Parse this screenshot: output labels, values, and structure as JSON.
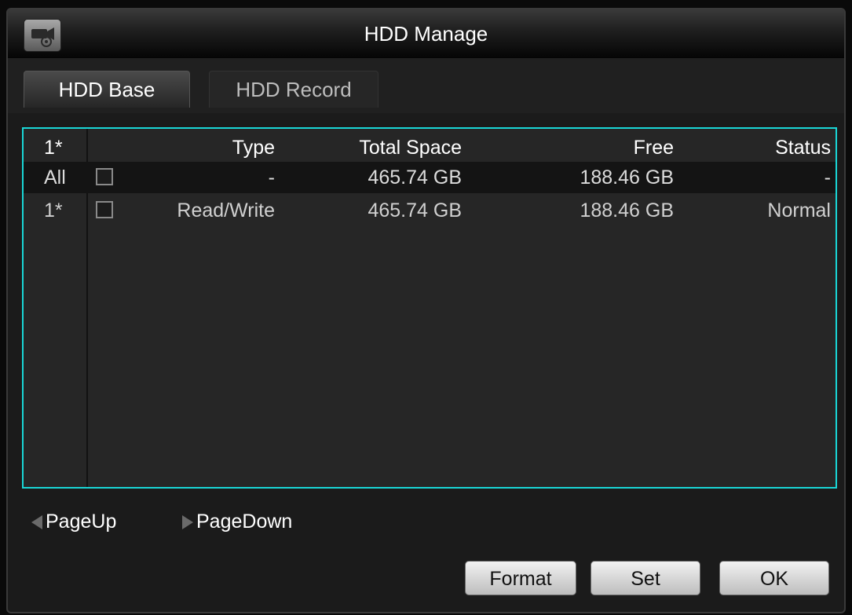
{
  "window": {
    "title": "HDD Manage",
    "logo_icon": "camera-logo-icon"
  },
  "tabs": [
    {
      "label": "HDD Base",
      "active": true
    },
    {
      "label": "HDD Record",
      "active": false
    }
  ],
  "table": {
    "columns": {
      "index": "1*",
      "type": "Type",
      "total": "Total Space",
      "free": "Free",
      "status": "Status"
    },
    "rows": [
      {
        "index": "All",
        "type": "-",
        "total": "465.74 GB",
        "free": "188.46 GB",
        "status": "-",
        "checked": false
      },
      {
        "index": "1*",
        "type": "Read/Write",
        "total": "465.74 GB",
        "free": "188.46 GB",
        "status": "Normal",
        "checked": false
      }
    ]
  },
  "pager": {
    "up_label": "PageUp",
    "down_label": "PageDown"
  },
  "buttons": {
    "format_label": "Format",
    "set_label": "Set",
    "ok_label": "OK"
  },
  "colors": {
    "accent": "#19d6d6",
    "background": "#1b1b1b"
  }
}
